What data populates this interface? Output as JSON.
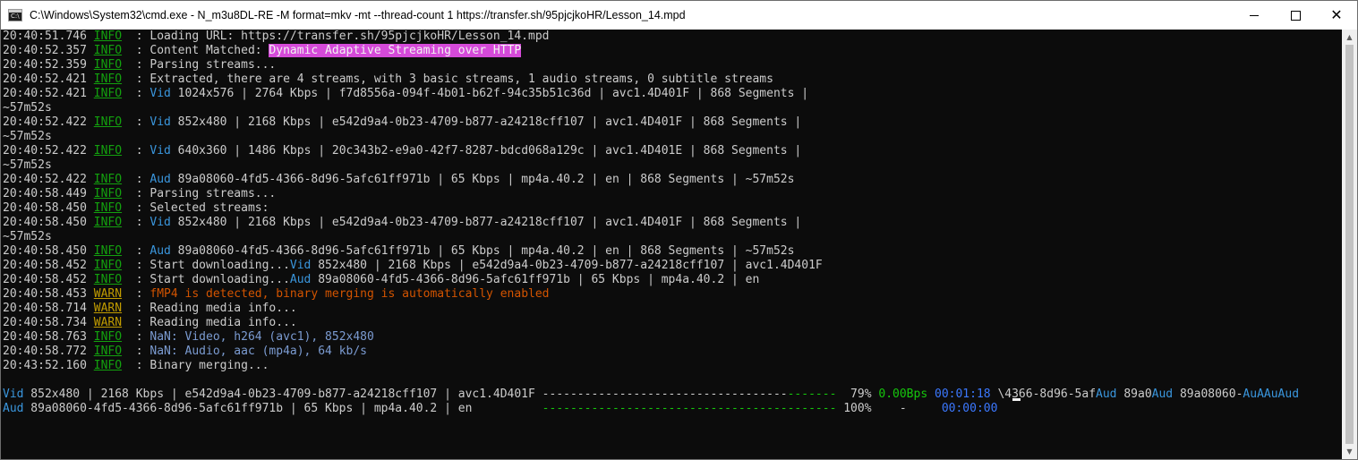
{
  "window": {
    "title": "C:\\Windows\\System32\\cmd.exe - N_m3u8DL-RE  -M format=mkv -mt --thread-count 1 https://transfer.sh/95pjcjkoHR/Lesson_14.mpd",
    "min_icon": "minimize-icon",
    "max_icon": "maximize-icon",
    "close_icon": "close-icon"
  },
  "log": {
    "l0": {
      "t": "20:40:51.746",
      "lv": "INFO",
      "msg": " : Loading URL: https://transfer.sh/95pjcjkoHR/Lesson_14.mpd"
    },
    "l1": {
      "t": "20:40:52.357",
      "lv": "INFO",
      "pre": " : Content Matched: ",
      "hl": "Dynamic Adaptive Streaming over HTTP"
    },
    "l2": {
      "t": "20:40:52.359",
      "lv": "INFO",
      "msg": " : Parsing streams..."
    },
    "l3": {
      "t": "20:40:52.421",
      "lv": "INFO",
      "msg": " : Extracted, there are 4 streams, with 3 basic streams, 1 audio streams, 0 subtitle streams"
    },
    "l4": {
      "t": "20:40:52.421",
      "lv": "INFO",
      "pre": " : ",
      "tag": "Vid",
      "msg": " 1024x576 | 2764 Kbps | f7d8556a-094f-4b01-b62f-94c35b51c36d | avc1.4D401F | 868 Segments |"
    },
    "l5": {
      "msg": "~57m52s"
    },
    "l6": {
      "t": "20:40:52.422",
      "lv": "INFO",
      "pre": " : ",
      "tag": "Vid",
      "msg": " 852x480 | 2168 Kbps | e542d9a4-0b23-4709-b877-a24218cff107 | avc1.4D401F | 868 Segments |"
    },
    "l7": {
      "msg": "~57m52s"
    },
    "l8": {
      "t": "20:40:52.422",
      "lv": "INFO",
      "pre": " : ",
      "tag": "Vid",
      "msg": " 640x360 | 1486 Kbps | 20c343b2-e9a0-42f7-8287-bdcd068a129c | avc1.4D401E | 868 Segments |"
    },
    "l9": {
      "msg": "~57m52s"
    },
    "l10": {
      "t": "20:40:52.422",
      "lv": "INFO",
      "pre": " : ",
      "tag": "Aud",
      "msg": " 89a08060-4fd5-4366-8d96-5afc61ff971b | 65 Kbps | mp4a.40.2 | en | 868 Segments | ~57m52s"
    },
    "l11": {
      "t": "20:40:58.449",
      "lv": "INFO",
      "msg": " : Parsing streams..."
    },
    "l12": {
      "t": "20:40:58.450",
      "lv": "INFO",
      "msg": " : Selected streams:"
    },
    "l13": {
      "t": "20:40:58.450",
      "lv": "INFO",
      "pre": " : ",
      "tag": "Vid",
      "msg": " 852x480 | 2168 Kbps | e542d9a4-0b23-4709-b877-a24218cff107 | avc1.4D401F | 868 Segments |"
    },
    "l14": {
      "msg": "~57m52s"
    },
    "l15": {
      "t": "20:40:58.450",
      "lv": "INFO",
      "pre": " : ",
      "tag": "Aud",
      "msg": " 89a08060-4fd5-4366-8d96-5afc61ff971b | 65 Kbps | mp4a.40.2 | en | 868 Segments | ~57m52s"
    },
    "l16": {
      "t": "20:40:58.452",
      "lv": "INFO",
      "pre": " : Start downloading...",
      "tag": "Vid",
      "msg": " 852x480 | 2168 Kbps | e542d9a4-0b23-4709-b877-a24218cff107 | avc1.4D401F"
    },
    "l17": {
      "t": "20:40:58.452",
      "lv": "INFO",
      "pre": " : Start downloading...",
      "tag": "Aud",
      "msg": " 89a08060-4fd5-4366-8d96-5afc61ff971b | 65 Kbps | mp4a.40.2 | en"
    },
    "l18": {
      "t": "20:40:58.453",
      "lv": "WARN",
      "pre": " : ",
      "warn": "fMP4 is detected, binary merging is automatically enabled"
    },
    "l19": {
      "t": "20:40:58.714",
      "lv": "WARN",
      "msg": " : Reading media info..."
    },
    "l20": {
      "t": "20:40:58.734",
      "lv": "WARN",
      "msg": " : Reading media info..."
    },
    "l21": {
      "t": "20:40:58.763",
      "lv": "INFO",
      "pre": " : ",
      "media": "NaN: Video, h264 (avc1), 852x480"
    },
    "l22": {
      "t": "20:40:58.772",
      "lv": "INFO",
      "pre": " : ",
      "media": "NaN: Audio, aac (mp4a), 64 kb/s"
    },
    "l23": {
      "t": "20:43:52.160",
      "lv": "INFO",
      "msg": " : Binary merging..."
    }
  },
  "progress": {
    "video": {
      "tag": "Vid",
      "info": " 852x480 | 2168 Kbps | e542d9a4-0b23-4709-b877-a24218cff107 | avc1.4D401F ",
      "bar_done": "-----------------------------------",
      "bar_rest": "-------",
      "percent": "  79%",
      "speed": "0.00Bps",
      "eta": "00:01:18",
      "tail1": " \\4366-8d96-5af",
      "tail2": "Aud",
      "tail3": " 89a0",
      "tail4": "Aud",
      "tail5": " 89a08060-",
      "tail6": "AuAAuAud"
    },
    "audio": {
      "tag": "Aud",
      "info": " 89a08060-4fd5-4366-8d96-5afc61ff971b | 65 Kbps | mp4a.40.2 | en          ",
      "bar_done": "------------------------------------------",
      "percent": " 100%",
      "speed": "-",
      "eta": "00:00:00"
    }
  },
  "colors": {
    "background": "#0c0c0c",
    "text": "#cccccc",
    "info": "#13a10e",
    "warn": "#c19c00",
    "stream_tag": "#3a96dd",
    "warn_text": "#d35400",
    "highlight_bg": "#d54ad9",
    "progress_bar": "#16c60c",
    "eta": "#3b78ff"
  }
}
